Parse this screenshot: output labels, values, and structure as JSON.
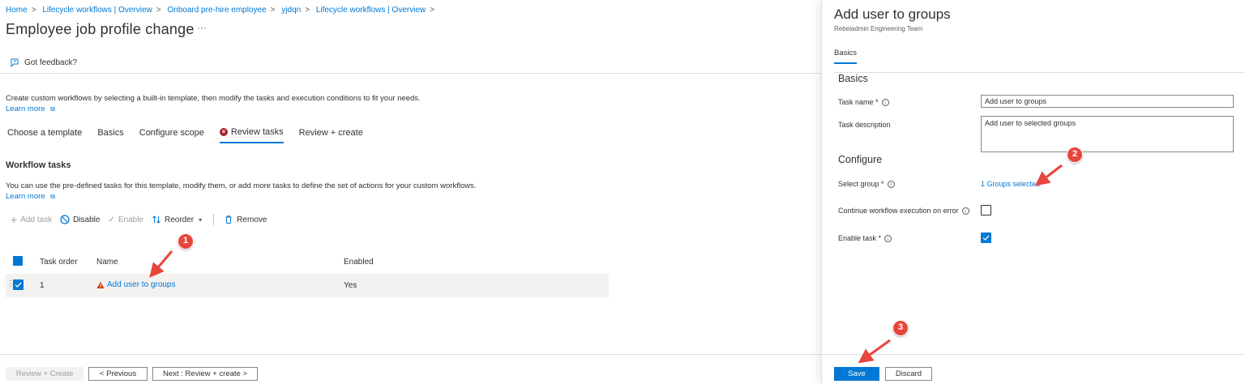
{
  "breadcrumb": [
    "Home",
    "Lifecycle workflows | Overview",
    "Onboard pre-hire employee",
    "yjdqn",
    "Lifecycle workflows | Overview"
  ],
  "page": {
    "title": "Employee job profile change",
    "more": "···",
    "feedback": "Got feedback?",
    "intro": "Create custom workflows by selecting a built-in template, then modify the tasks and execution conditions to fit your needs.",
    "learn_more": "Learn more"
  },
  "tabs": [
    "Choose a template",
    "Basics",
    "Configure scope",
    "Review tasks",
    "Review + create"
  ],
  "active_tab": "Review tasks",
  "workflow": {
    "title": "Workflow tasks",
    "description": "You can use the pre-defined tasks for this template, modify them, or add more tasks to define the set of actions for your custom workflows.",
    "learn_more": "Learn more"
  },
  "toolbar": {
    "add": "Add task",
    "disable": "Disable",
    "enable": "Enable",
    "reorder": "Reorder",
    "remove": "Remove"
  },
  "table": {
    "headers": {
      "order": "Task order",
      "name": "Name",
      "enabled": "Enabled"
    },
    "rows": [
      {
        "order": "1",
        "name": "Add user to groups",
        "enabled": "Yes"
      }
    ]
  },
  "footer": {
    "review_create": "Review + Create",
    "previous": "< Previous",
    "next": "Next : Review + create >"
  },
  "panel": {
    "title": "Add user to groups",
    "subtitle": "Rebeladmin Engineering Team",
    "tab": "Basics",
    "basics_heading": "Basics",
    "task_name_label": "Task name *",
    "task_name_value": "Add user to groups",
    "task_desc_label": "Task description",
    "task_desc_value": "Add user to selected groups",
    "configure_heading": "Configure",
    "select_group_label": "Select group *",
    "groups_selected": "1 Groups selected",
    "continue_label": "Continue workflow execution on error",
    "enable_label": "Enable task *",
    "continue_checked": false,
    "enable_checked": true,
    "save": "Save",
    "discard": "Discard"
  },
  "callouts": [
    "1",
    "2",
    "3"
  ],
  "colors": {
    "accent": "#0078d4",
    "callout": "#e8453c",
    "warning": "#d83b01"
  }
}
